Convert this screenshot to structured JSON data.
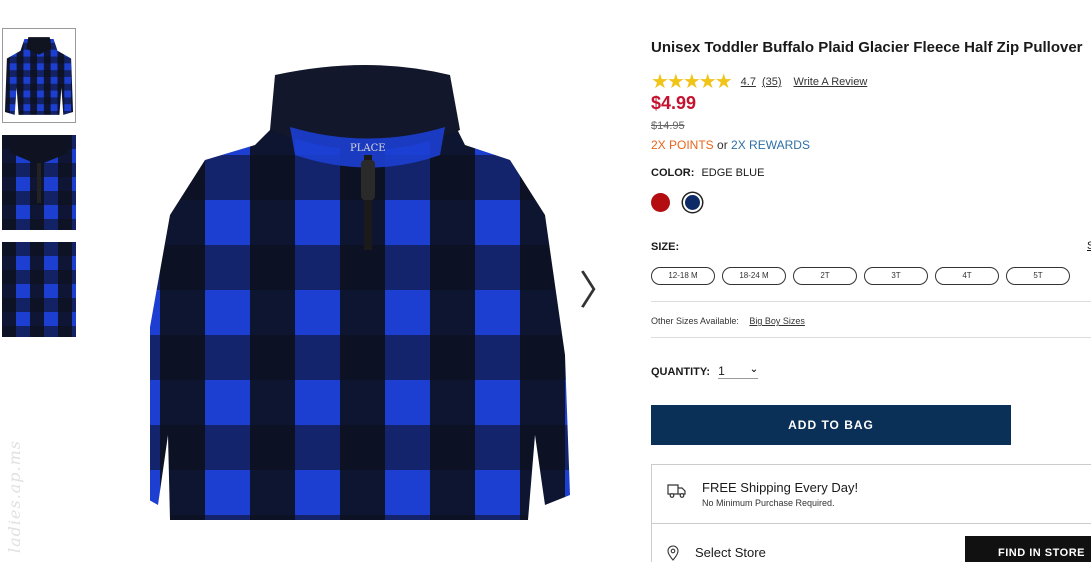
{
  "product": {
    "title": "Unisex Toddler Buffalo Plaid Glacier Fleece Half Zip Pullover",
    "stars": "★★★★★",
    "rating": "4.7",
    "review_count": "(35)",
    "write_review": "Write A Review",
    "price": "$4.99",
    "original_price": "$14.95",
    "points_text": "2X POINTS",
    "or_text": "or",
    "rewards_text": "2X REWARDS",
    "brand_label": "PLACE"
  },
  "color": {
    "label": "COLOR:",
    "selected": "EDGE BLUE",
    "swatches": [
      {
        "name": "red",
        "hex": "#b30d12"
      },
      {
        "name": "edge-blue",
        "hex": "#0d2a66",
        "selected": true
      }
    ]
  },
  "size": {
    "label": "SIZE:",
    "guide_clip": "S",
    "options": [
      "12-18 M",
      "18-24 M",
      "2T",
      "3T",
      "4T",
      "5T"
    ]
  },
  "other_sizes": {
    "label": "Other Sizes Available:",
    "link": "Big Boy Sizes"
  },
  "quantity": {
    "label": "QUANTITY:",
    "value": "1"
  },
  "add_to_bag": "ADD TO BAG",
  "shipping": {
    "title": "FREE Shipping Every Day!",
    "subtitle": "No Minimum Purchase Required.",
    "select_store": "Select Store",
    "find_in_store": "FIND IN STORE"
  },
  "gallery": {
    "prev_arrow": "〈",
    "next_arrow": "〉",
    "watermark": "ladies.ap.ms"
  },
  "colors": {
    "accent_price": "#c4122f",
    "points": "#e8641b",
    "rewards": "#2f6fa6",
    "primary_button": "#0b3057",
    "plaid_blue": "#1c3fd1",
    "plaid_black": "#0d0f1a"
  }
}
